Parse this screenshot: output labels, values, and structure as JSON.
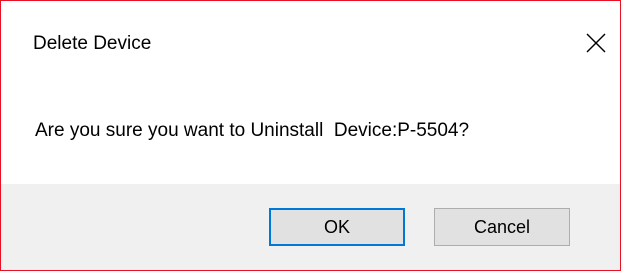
{
  "dialog": {
    "title": "Delete Device",
    "close_icon": "close-icon",
    "message": "Are you sure you want to Uninstall  Device:P-5504?",
    "buttons": {
      "ok_label": "OK",
      "cancel_label": "Cancel"
    },
    "colors": {
      "border": "#e81123",
      "footer_background": "#f0f0f0",
      "focus_border": "#0078d7",
      "button_background": "#e1e1e1"
    }
  }
}
